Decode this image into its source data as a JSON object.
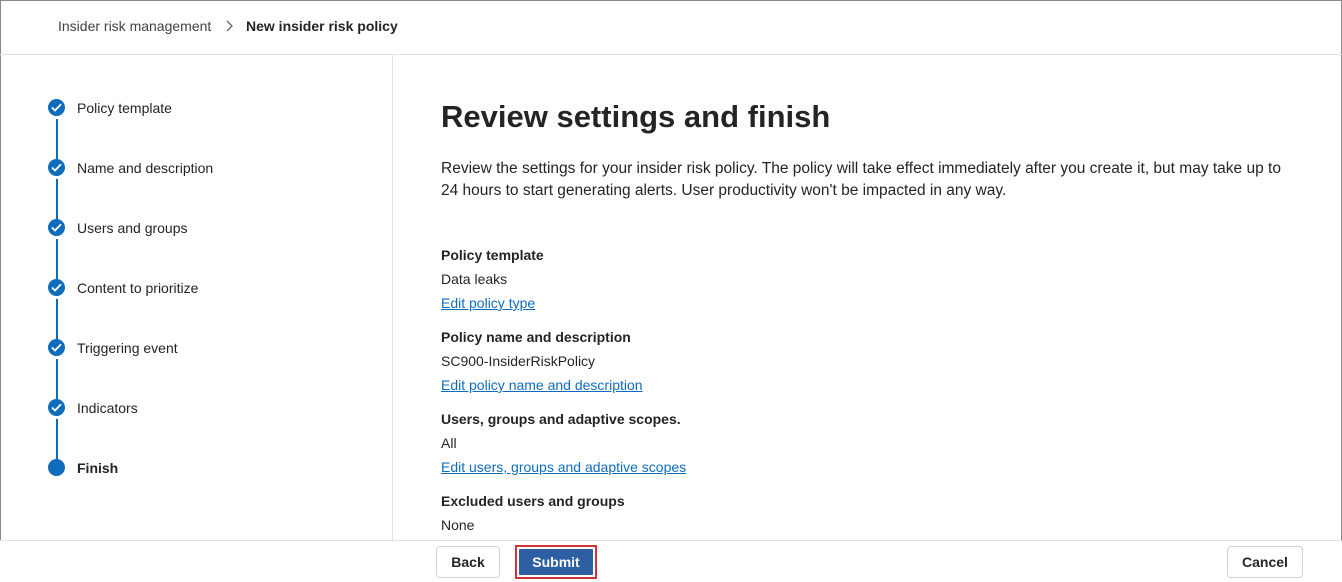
{
  "breadcrumb": {
    "root": "Insider risk management",
    "current": "New insider risk policy"
  },
  "steps": [
    {
      "label": "Policy template",
      "state": "complete"
    },
    {
      "label": "Name and description",
      "state": "complete"
    },
    {
      "label": "Users and groups",
      "state": "complete"
    },
    {
      "label": "Content to prioritize",
      "state": "complete"
    },
    {
      "label": "Triggering event",
      "state": "complete"
    },
    {
      "label": "Indicators",
      "state": "complete"
    },
    {
      "label": "Finish",
      "state": "current"
    }
  ],
  "main": {
    "title": "Review settings and finish",
    "intro": "Review the settings for your insider risk policy. The policy will take effect immediately after you create it, but may take up to 24 hours to start generating alerts. User productivity won't be impacted in any way.",
    "sections": [
      {
        "heading": "Policy template",
        "value": "Data leaks",
        "link": "Edit policy type"
      },
      {
        "heading": "Policy name and description",
        "value": "SC900-InsiderRiskPolicy",
        "link": "Edit policy name and description"
      },
      {
        "heading": "Users, groups and adaptive scopes.",
        "value": "All",
        "link": "Edit users, groups and adaptive scopes"
      },
      {
        "heading": "Excluded users and groups",
        "value": "None"
      }
    ]
  },
  "footer": {
    "back_label": "Back",
    "submit_label": "Submit",
    "cancel_label": "Cancel"
  },
  "colors": {
    "accent": "#0f6cbd",
    "submit_bg": "#2e5fa3",
    "highlight_border": "#d13438"
  },
  "icons": {
    "step_complete": "checkmark-circle-icon",
    "step_current": "filled-circle-icon",
    "breadcrumb_separator": "chevron-right-icon"
  }
}
